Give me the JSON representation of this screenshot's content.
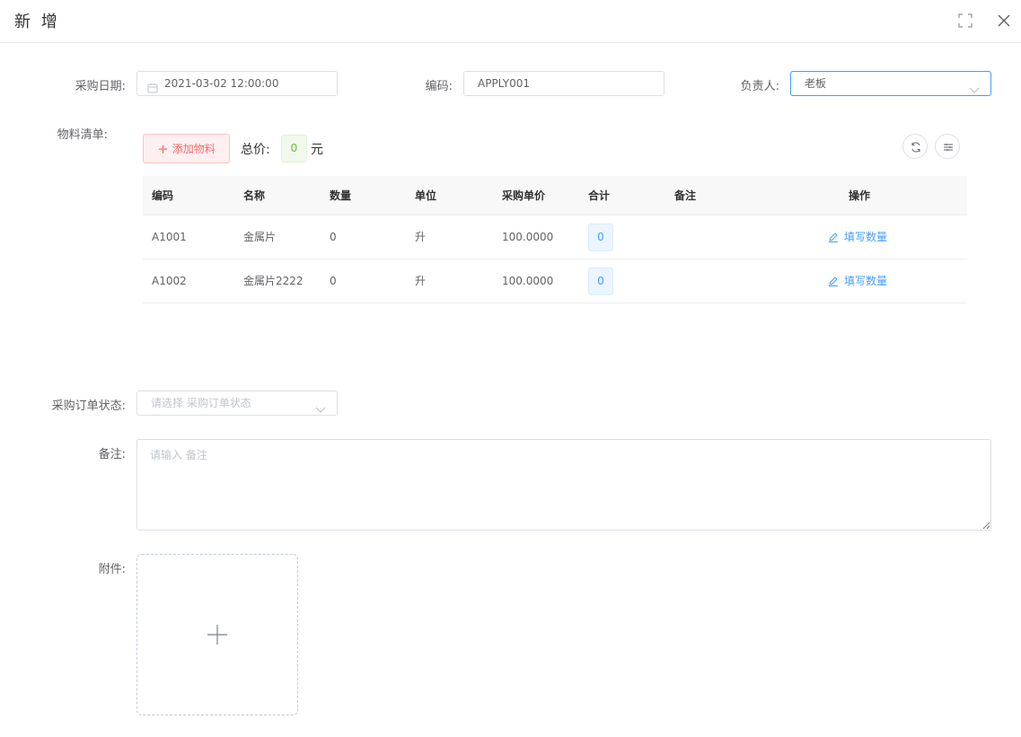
{
  "dialog": {
    "title": "新 增",
    "icons": {
      "fullscreen": "fullscreen-icon",
      "close": "close-icon"
    }
  },
  "form": {
    "purchase_date": {
      "label": "采购日期:",
      "value": "2021-03-02 12:00:00",
      "icon": "calendar-icon"
    },
    "code": {
      "label": "编码:",
      "value": "APPLY001"
    },
    "owner": {
      "label": "负责人:",
      "value": "老板",
      "icon": "chevron-down-icon"
    },
    "materials": {
      "label": "物料清单:",
      "add_button": "添加物料",
      "total_label": "总价:",
      "total_value": "0",
      "total_unit": "元",
      "tool_icons": [
        "refresh-icon",
        "column-settings-icon"
      ],
      "columns": [
        "编码",
        "名称",
        "数量",
        "单位",
        "采购单价",
        "合计",
        "备注",
        "操作"
      ],
      "rows": [
        {
          "code": "A1001",
          "name": "金属片",
          "qty": "0",
          "unit": "升",
          "price": "100.0000",
          "total": "0",
          "remark": "",
          "action": "填写数量"
        },
        {
          "code": "A1002",
          "name": "金属片2222",
          "qty": "0",
          "unit": "升",
          "price": "100.0000",
          "total": "0",
          "remark": "",
          "action": "填写数量"
        }
      ]
    },
    "status": {
      "label": "采购订单状态:",
      "placeholder": "请选择 采购订单状态"
    },
    "remark": {
      "label": "备注:",
      "placeholder": "请输入 备注"
    },
    "attachment": {
      "label": "附件:",
      "icon": "plus-icon"
    }
  },
  "colors": {
    "primary": "#409eff",
    "danger": "#f56c6c",
    "success": "#67c23a",
    "border": "#dcdfe6"
  }
}
